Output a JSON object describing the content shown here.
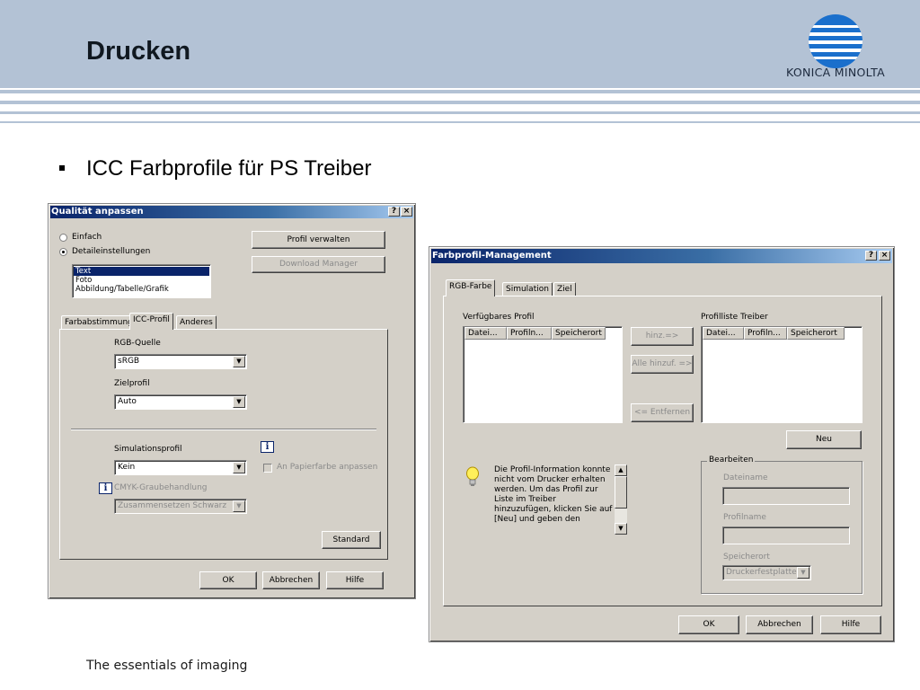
{
  "slide": {
    "title": "Drucken",
    "logo_text": "KONICA MINOLTA",
    "bullet": "ICC Farbprofile für PS Treiber",
    "footer": "The essentials of imaging"
  },
  "dialog1": {
    "title": "Qualität anpassen",
    "help_btn": "?",
    "close_btn": "×",
    "radio_einfach": "Einfach",
    "radio_detail": "Detaileinstellungen",
    "list_items": [
      "Text",
      "Foto",
      "Abbildung/Tabelle/Grafik"
    ],
    "btn_profil_verwalten": "Profil verwalten",
    "btn_download_manager": "Download Manager",
    "tabs": [
      "Farbabstimmung",
      "ICC-Profil",
      "Anderes"
    ],
    "rgb_quelle_label": "RGB-Quelle",
    "rgb_quelle_value": "sRGB",
    "zielprofil_label": "Zielprofil",
    "zielprofil_value": "Auto",
    "simulationsprofil_label": "Simulationsprofil",
    "simulationsprofil_value": "Kein",
    "papierfarbe_label": "An Papierfarbe anpassen",
    "cmyk_label": "CMYK-Graubehandlung",
    "cmyk_value": "Zusammensetzen Schwarz",
    "btn_standard": "Standard",
    "btn_ok": "OK",
    "btn_abbrechen": "Abbrechen",
    "btn_hilfe": "Hilfe"
  },
  "dialog2": {
    "title": "Farbprofil-Management",
    "help_btn": "?",
    "close_btn": "×",
    "tabs": [
      "RGB-Farbe",
      "Simulation",
      "Ziel"
    ],
    "verfuegbar_label": "Verfügbares Profil",
    "profilliste_label": "Profilliste Treiber",
    "columns": [
      "Datei...",
      "Profiln...",
      "Speicherort"
    ],
    "btn_hinzu": "hinz.=>",
    "btn_alle_hinzu": "Alle hinzuf. =>",
    "btn_entfernen": "<= Entfernen",
    "btn_neu": "Neu",
    "info_lines": [
      "Die Profil-Information konnte",
      "nicht vom Drucker erhalten",
      "werden. Um das Profil zur",
      "Liste im Treiber",
      "hinzuzufügen, klicken Sie auf",
      "[Neu] und geben den"
    ],
    "bearbeiten_label": "Bearbeiten",
    "dateiname_label": "Dateiname",
    "profilname_label": "Profilname",
    "speicherort_label": "Speicherort",
    "speicherort_value": "Druckerfestplatte",
    "btn_ok": "OK",
    "btn_abbrechen": "Abbrechen",
    "btn_hilfe": "Hilfe"
  },
  "colors": {
    "header_band": "#b3c2d5",
    "titlebar_start": "#0a246a",
    "titlebar_end": "#a6caf0",
    "logo_blue": "#1a6fcc",
    "dialog_face": "#d4d0c8"
  }
}
